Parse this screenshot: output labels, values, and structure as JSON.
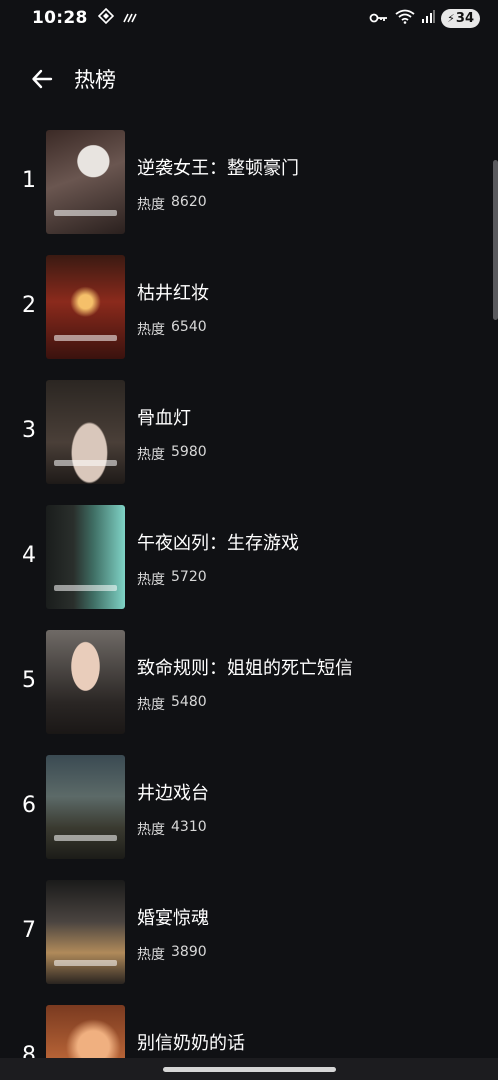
{
  "status_bar": {
    "time": "10:28",
    "battery": "34"
  },
  "header": {
    "title": "热榜"
  },
  "list": {
    "heat_label": "热度",
    "items": [
      {
        "rank": "1",
        "title": "逆袭女王：整顿豪门",
        "heat": "8620"
      },
      {
        "rank": "2",
        "title": "枯井红妆",
        "heat": "6540"
      },
      {
        "rank": "3",
        "title": "骨血灯",
        "heat": "5980"
      },
      {
        "rank": "4",
        "title": "午夜凶列：生存游戏",
        "heat": "5720"
      },
      {
        "rank": "5",
        "title": "致命规则：姐姐的死亡短信",
        "heat": "5480"
      },
      {
        "rank": "6",
        "title": "井边戏台",
        "heat": "4310"
      },
      {
        "rank": "7",
        "title": "婚宴惊魂",
        "heat": "3890"
      },
      {
        "rank": "8",
        "title": "别信奶奶的话",
        "heat": ""
      }
    ]
  }
}
